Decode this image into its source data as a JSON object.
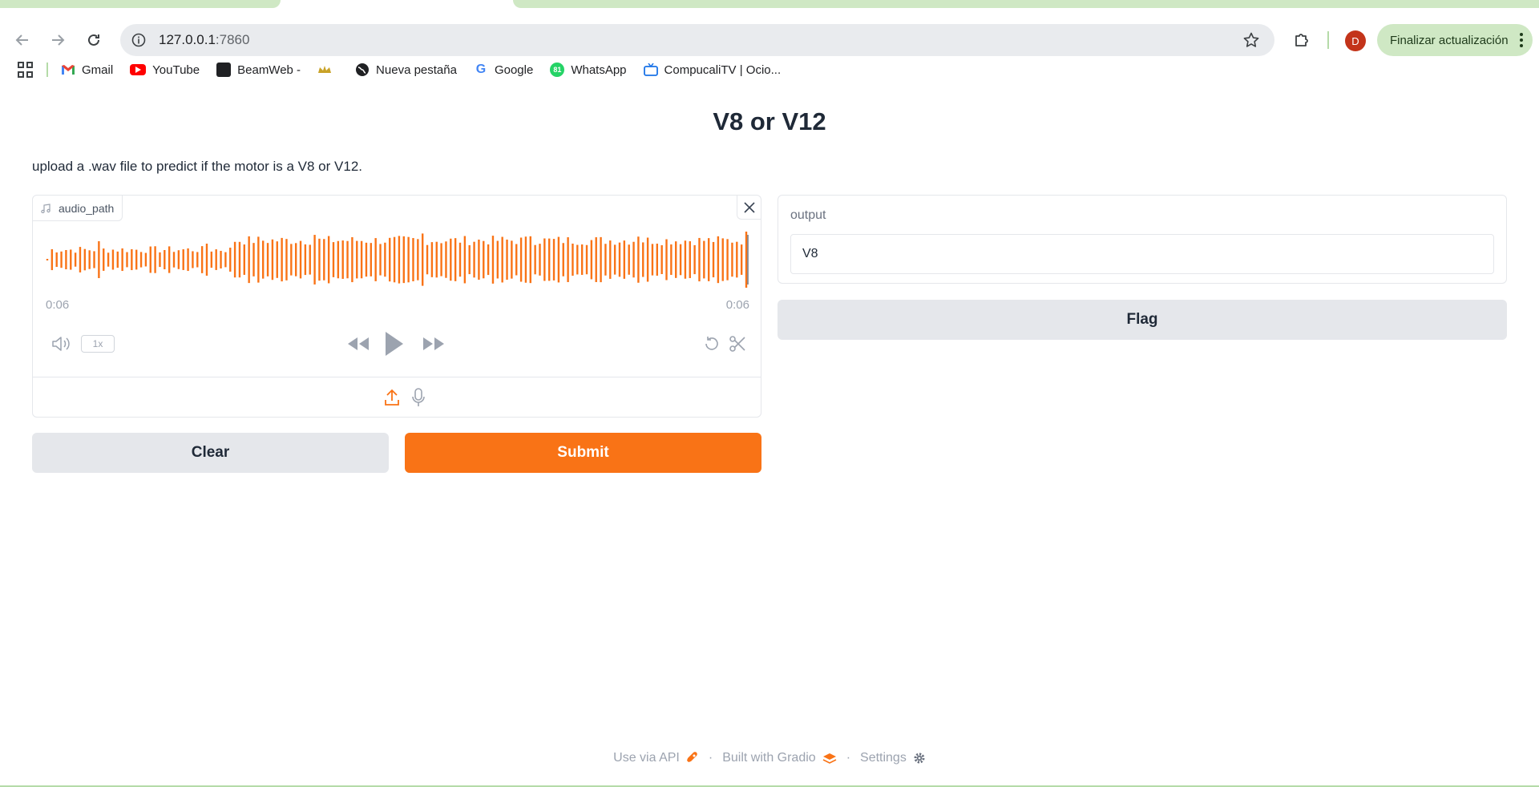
{
  "browser": {
    "url_host": "127.0.0.1",
    "url_port": ":7860",
    "avatar_initial": "D",
    "update_button_label": "Finalizar actualización",
    "bookmarks": [
      {
        "label": "Gmail",
        "icon": "gmail-icon"
      },
      {
        "label": "YouTube",
        "icon": "youtube-icon"
      },
      {
        "label": "BeamWeb -",
        "icon": "book-icon"
      },
      {
        "label": "",
        "icon": "crown-icon"
      },
      {
        "label": "Nueva pestaña",
        "icon": "globe-icon"
      },
      {
        "label": "Google",
        "icon": "google-icon"
      },
      {
        "label": "WhatsApp",
        "icon": "whatsapp-icon"
      },
      {
        "label": "CompucaliTV | Ocio...",
        "icon": "tv-icon"
      }
    ]
  },
  "app": {
    "title": "V8 or V12",
    "description": "upload a .wav file to predict if the motor is a V8 or V12.",
    "audio": {
      "label": "audio_path",
      "time_current": "0:06",
      "time_total": "0:06",
      "playback_speed": "1x"
    },
    "buttons": {
      "clear": "Clear",
      "submit": "Submit",
      "flag": "Flag"
    },
    "output": {
      "label": "output",
      "value": "V8"
    },
    "footer": {
      "api": "Use via API",
      "built": "Built with Gradio",
      "settings": "Settings"
    }
  },
  "colors": {
    "accent": "#f97316",
    "waveform": "#f97316",
    "secondary_button": "#e5e7eb",
    "update_pill": "#cfe8c4"
  }
}
